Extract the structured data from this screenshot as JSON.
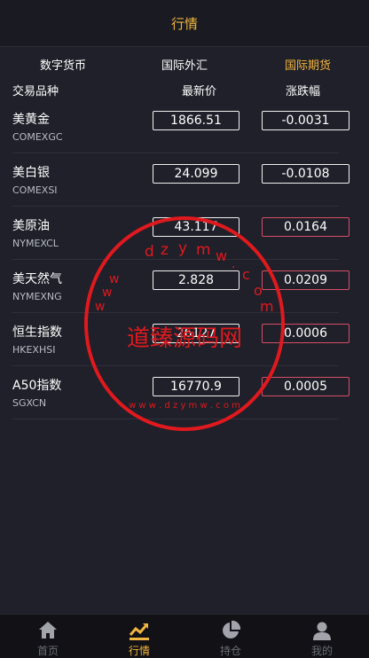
{
  "header": {
    "title": "行情"
  },
  "tabs": [
    {
      "label": "数字货币"
    },
    {
      "label": "国际外汇"
    },
    {
      "label": "国际期货"
    }
  ],
  "table": {
    "headers": [
      "交易品种",
      "最新价",
      "涨跌幅"
    ],
    "rows": [
      {
        "name": "美黄金",
        "code": "COMEXGC",
        "price": "1866.51",
        "change": "-0.0031"
      },
      {
        "name": "美白银",
        "code": "COMEXSI",
        "price": "24.099",
        "change": "-0.0108"
      },
      {
        "name": "美原油",
        "code": "NYMEXCL",
        "price": "43.117",
        "change": "0.0164"
      },
      {
        "name": "美天然气",
        "code": "NYMEXNG",
        "price": "2.828",
        "change": "0.0209"
      },
      {
        "name": "恒生指数",
        "code": "HKEXHSI",
        "price": "26127",
        "change": "0.0006"
      },
      {
        "name": "A50指数",
        "code": "SGXCN",
        "price": "16770.9",
        "change": "0.0005"
      }
    ]
  },
  "watermark": {
    "center_text": "道臻源码网",
    "top_letters": [
      "d",
      "z",
      "y",
      "m",
      "w",
      ".",
      "c",
      "o",
      "m",
      "w",
      "w",
      "w"
    ],
    "bottom_text": "w w w . d z y m w . c o m"
  },
  "tabbar": {
    "items": [
      {
        "label": "首页",
        "icon": "home-icon"
      },
      {
        "label": "行情",
        "icon": "chart-icon"
      },
      {
        "label": "持仓",
        "icon": "pie-icon"
      },
      {
        "label": "我的",
        "icon": "user-icon"
      }
    ]
  },
  "colors": {
    "accent": "#f1b43c",
    "background": "#1f2029",
    "up_border": "#d64f66",
    "watermark": "#e0191e"
  }
}
